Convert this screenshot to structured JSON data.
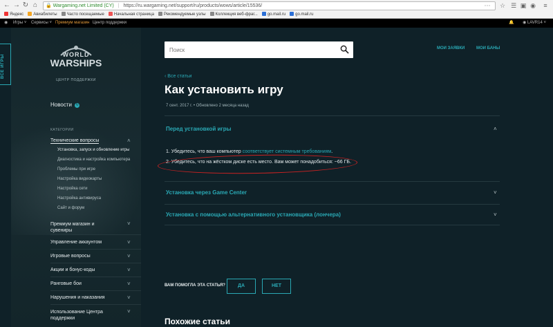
{
  "browser": {
    "url_company": "Wargaming.net Limited (CY)",
    "url": "https://ru.wargaming.net/support/ru/products/wows/article/15536/",
    "bookmarks": [
      {
        "label": "Яндекс",
        "color": "#e33"
      },
      {
        "label": "Авиабилеты",
        "color": "#f5a623"
      },
      {
        "label": "Часто посещаемые",
        "color": "#888"
      },
      {
        "label": "Начальная страница",
        "color": "#e55"
      },
      {
        "label": "Рекомендуемые узлы",
        "color": "#888"
      },
      {
        "label": "Коллекция веб-фраг...",
        "color": "#888"
      },
      {
        "label": "go.mail.ru",
        "color": "#2b6fd6"
      },
      {
        "label": "go.mail.ru",
        "color": "#2b6fd6"
      }
    ]
  },
  "topnav": {
    "games": "Игры",
    "services": "Сервисы",
    "premium_shop": "Премиум магазин",
    "support_center": "Центр поддержки",
    "username": "LAVR14"
  },
  "sidebar": {
    "vertical_tab": "ВСЕ ИГРЫ",
    "logo_line1": "WORLD",
    "logo_line2": "WARSHIPS",
    "logo_sub": "ЦЕНТР ПОДДЕРЖКИ",
    "news_label": "Новости",
    "categories_label": "КАТЕГОРИИ",
    "tech_questions": "Технические вопросы",
    "sub_items": [
      "Установка, запуск и обновление игры",
      "Диагностика и настройка компьютера",
      "Проблемы при игре",
      "Настройка видеокарты",
      "Настройка сети",
      "Настройка антивируса",
      "Сайт и форум"
    ],
    "premium_line1": "Премиум магазин и",
    "premium_line2": "сувениры",
    "account": "Управление аккаунтом",
    "game_questions": "Игровые вопросы",
    "promo": "Акции и бонус-коды",
    "ranked": "Ранговые бои",
    "violations": "Нарушения и наказания",
    "use_line1": "Использование Центра",
    "use_line2": "поддержки"
  },
  "main": {
    "search_placeholder": "Поиск",
    "my_requests": "МОИ ЗАЯВКИ",
    "my_bans": "МОИ БАНЫ",
    "back_link": "Все статьи",
    "title": "Как установить игру",
    "meta": "7 сент. 2017 г. • Обновлено 2 месяца назад",
    "sections": {
      "before_install": "Перед установкой игры",
      "via_game_center": "Установка через Game Center",
      "via_launcher": "Установка с помощью альтернативного установщика (лончера)"
    },
    "list": {
      "item1_prefix": "1.  Убедитесь, что ваш компьютер",
      "item1_link": "соответствует системным требованиям",
      "item1_suffix": ".",
      "item2": "2.  Убедитесь, что на жёстком диске есть место. Вам может понадобиться: ~66 ГБ."
    },
    "feedback": {
      "question": "ВАМ ПОМОГЛА ЭТА СТАТЬЯ?",
      "yes": "ДА",
      "no": "НЕТ"
    },
    "similar_articles": "Похожие статьи"
  }
}
